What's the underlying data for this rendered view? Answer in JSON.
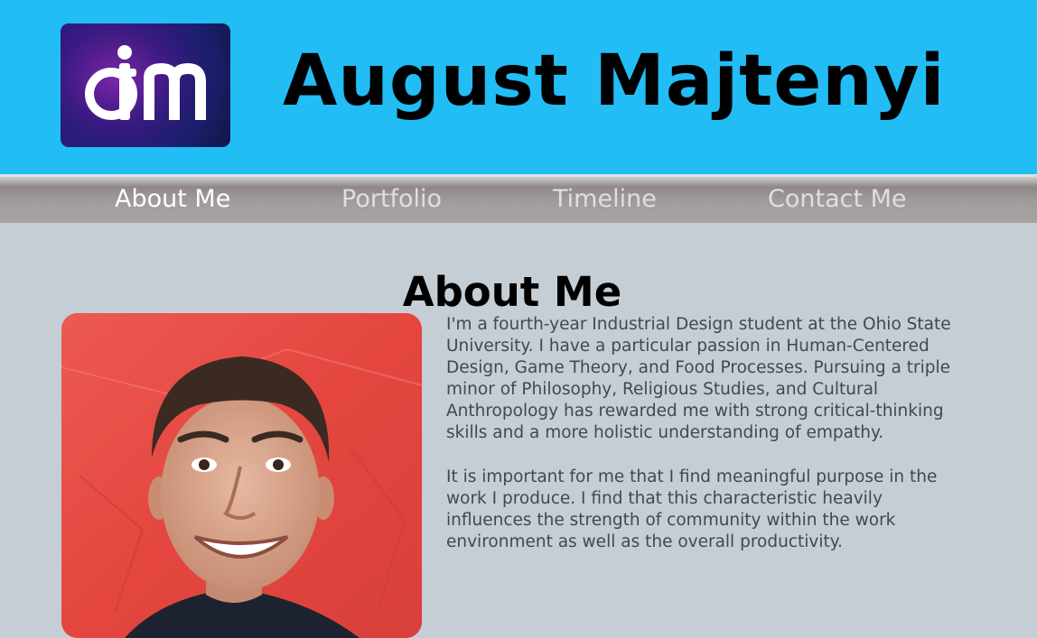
{
  "header": {
    "logo_text": "am",
    "site_title": "August Majtenyi"
  },
  "nav": {
    "items": [
      {
        "label": "About Me",
        "active": true
      },
      {
        "label": "Portfolio",
        "active": false
      },
      {
        "label": "Timeline",
        "active": false
      },
      {
        "label": "Contact Me",
        "active": false
      }
    ]
  },
  "main": {
    "title": "About Me",
    "bio_paragraphs": [
      "I'm a fourth-year Industrial Design student at the Ohio State University. I have a particular passion in Human-Centered Design, Game Theory, and Food Processes. Pursuing a triple minor of Philosophy, Religious Studies, and Cultural Anthropology has rewarded me with strong critical-thinking skills and a more holistic understanding of empathy.",
      "It is important for me that I find meaningful purpose in the work I produce. I find that this characteristic heavily influences the strength of community within the work environment as well as the overall productivity."
    ]
  },
  "colors": {
    "header_bg": "#22bdf5",
    "page_bg": "#c5ced5",
    "nav_active": "#ffffff",
    "nav_inactive": "#e1dede",
    "body_text": "#474747"
  }
}
